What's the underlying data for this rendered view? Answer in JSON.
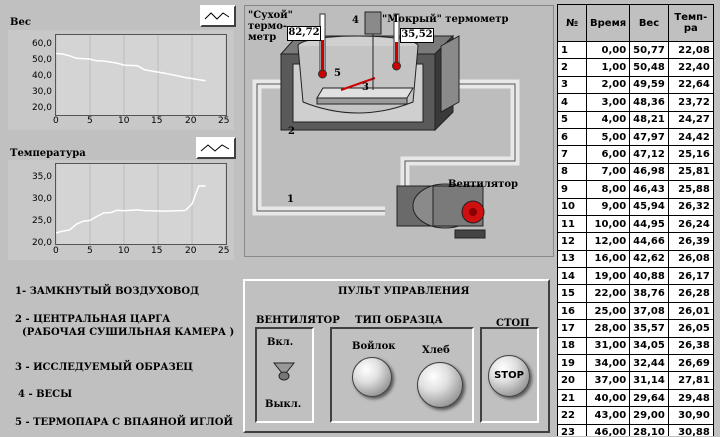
{
  "weight_chart": {
    "title": "Вес",
    "yticks": [
      "60,0",
      "50,0",
      "40,0",
      "30,0",
      "20,0"
    ],
    "xticks": [
      "0",
      "5",
      "10",
      "15",
      "20",
      "25"
    ]
  },
  "temp_chart": {
    "title": "Температура",
    "yticks": [
      "35,0",
      "30,0",
      "25,0",
      "20,0"
    ],
    "xticks": [
      "0",
      "5",
      "10",
      "15",
      "20",
      "25"
    ]
  },
  "chart_data": [
    {
      "type": "line",
      "title": "Вес",
      "xlim": [
        0,
        25
      ],
      "ylim": [
        20,
        60
      ],
      "x": [
        0,
        1,
        2,
        3,
        4,
        5,
        6,
        7,
        8,
        9,
        10,
        12,
        13,
        16,
        19,
        22
      ],
      "y": [
        50.77,
        50.48,
        49.59,
        48.36,
        48.21,
        47.97,
        47.12,
        46.98,
        46.43,
        45.94,
        44.95,
        44.66,
        42.62,
        40.88,
        38.76,
        37.08
      ]
    },
    {
      "type": "line",
      "title": "Температура",
      "xlim": [
        0,
        25
      ],
      "ylim": [
        20,
        35
      ],
      "x": [
        0,
        1,
        2,
        3,
        4,
        5,
        6,
        7,
        8,
        9,
        10,
        12,
        13,
        16,
        19,
        20,
        21,
        22
      ],
      "y": [
        22.08,
        22.4,
        22.64,
        23.72,
        24.27,
        24.42,
        25.16,
        25.81,
        25.88,
        26.32,
        26.24,
        26.39,
        26.26,
        26.17,
        26.28,
        27.5,
        30.9,
        30.88
      ]
    }
  ],
  "diagram": {
    "dry_label": "\"Сухой\"",
    "dry_label2": "термо-",
    "dry_label3": "метр",
    "dry_value": "82,72",
    "wet_label": "\"Мокрый\" термометр",
    "wet_value": "35,52",
    "n1": "1",
    "n2": "2",
    "n3": "3",
    "n4": "4",
    "n5": "5",
    "fan_label": "Вентилятор"
  },
  "legend": [
    "1- ЗАМКНУТЫЙ ВОЗДУХОВОД",
    "2 - ЦЕНТРАЛЬНАЯ ЦАРГА",
    "(РАБОЧАЯ СУШИЛЬНАЯ КАМЕРА )",
    "3 - ИССЛЕДУЕМЫЙ ОБРАЗЕЦ",
    "4 - ВЕСЫ",
    "5 - ТЕРМОПАРА С ВПАЯНОЙ ИГЛОЙ"
  ],
  "control": {
    "title": "ПУЛЬТ УПРАВЛЕНИЯ",
    "fan": "ВЕНТИЛЯТОР",
    "sample_type": "ТИП ОБРАЗЦА",
    "stop": "СТОП",
    "on": "Вкл.",
    "off": "Выкл.",
    "felt": "Войлок",
    "bread": "Хлеб",
    "stop_button": "STOP"
  },
  "table": {
    "headers": [
      "№",
      "Время",
      "Вес",
      "Темп-ра"
    ],
    "rows": [
      [
        "1",
        "0,00",
        "50,77",
        "22,08"
      ],
      [
        "2",
        "1,00",
        "50,48",
        "22,40"
      ],
      [
        "3",
        "2,00",
        "49,59",
        "22,64"
      ],
      [
        "4",
        "3,00",
        "48,36",
        "23,72"
      ],
      [
        "5",
        "4,00",
        "48,21",
        "24,27"
      ],
      [
        "6",
        "5,00",
        "47,97",
        "24,42"
      ],
      [
        "7",
        "6,00",
        "47,12",
        "25,16"
      ],
      [
        "8",
        "7,00",
        "46,98",
        "25,81"
      ],
      [
        "9",
        "8,00",
        "46,43",
        "25,88"
      ],
      [
        "10",
        "9,00",
        "45,94",
        "26,32"
      ],
      [
        "11",
        "10,00",
        "44,95",
        "26,24"
      ],
      [
        "12",
        "12,00",
        "44,66",
        "26,39"
      ],
      [
        "13",
        "16,00",
        "42,62",
        "26,08"
      ],
      [
        "14",
        "19,00",
        "40,88",
        "26,17"
      ],
      [
        "15",
        "22,00",
        "38,76",
        "26,28"
      ],
      [
        "16",
        "25,00",
        "37,08",
        "26,01"
      ],
      [
        "17",
        "28,00",
        "35,57",
        "26,05"
      ],
      [
        "18",
        "31,00",
        "34,05",
        "26,38"
      ],
      [
        "19",
        "34,00",
        "32,44",
        "26,69"
      ],
      [
        "20",
        "37,00",
        "31,14",
        "27,81"
      ],
      [
        "21",
        "40,00",
        "29,64",
        "29,48"
      ],
      [
        "22",
        "43,00",
        "29,00",
        "30,90"
      ],
      [
        "23",
        "46,00",
        "28,10",
        "30,88"
      ]
    ]
  }
}
